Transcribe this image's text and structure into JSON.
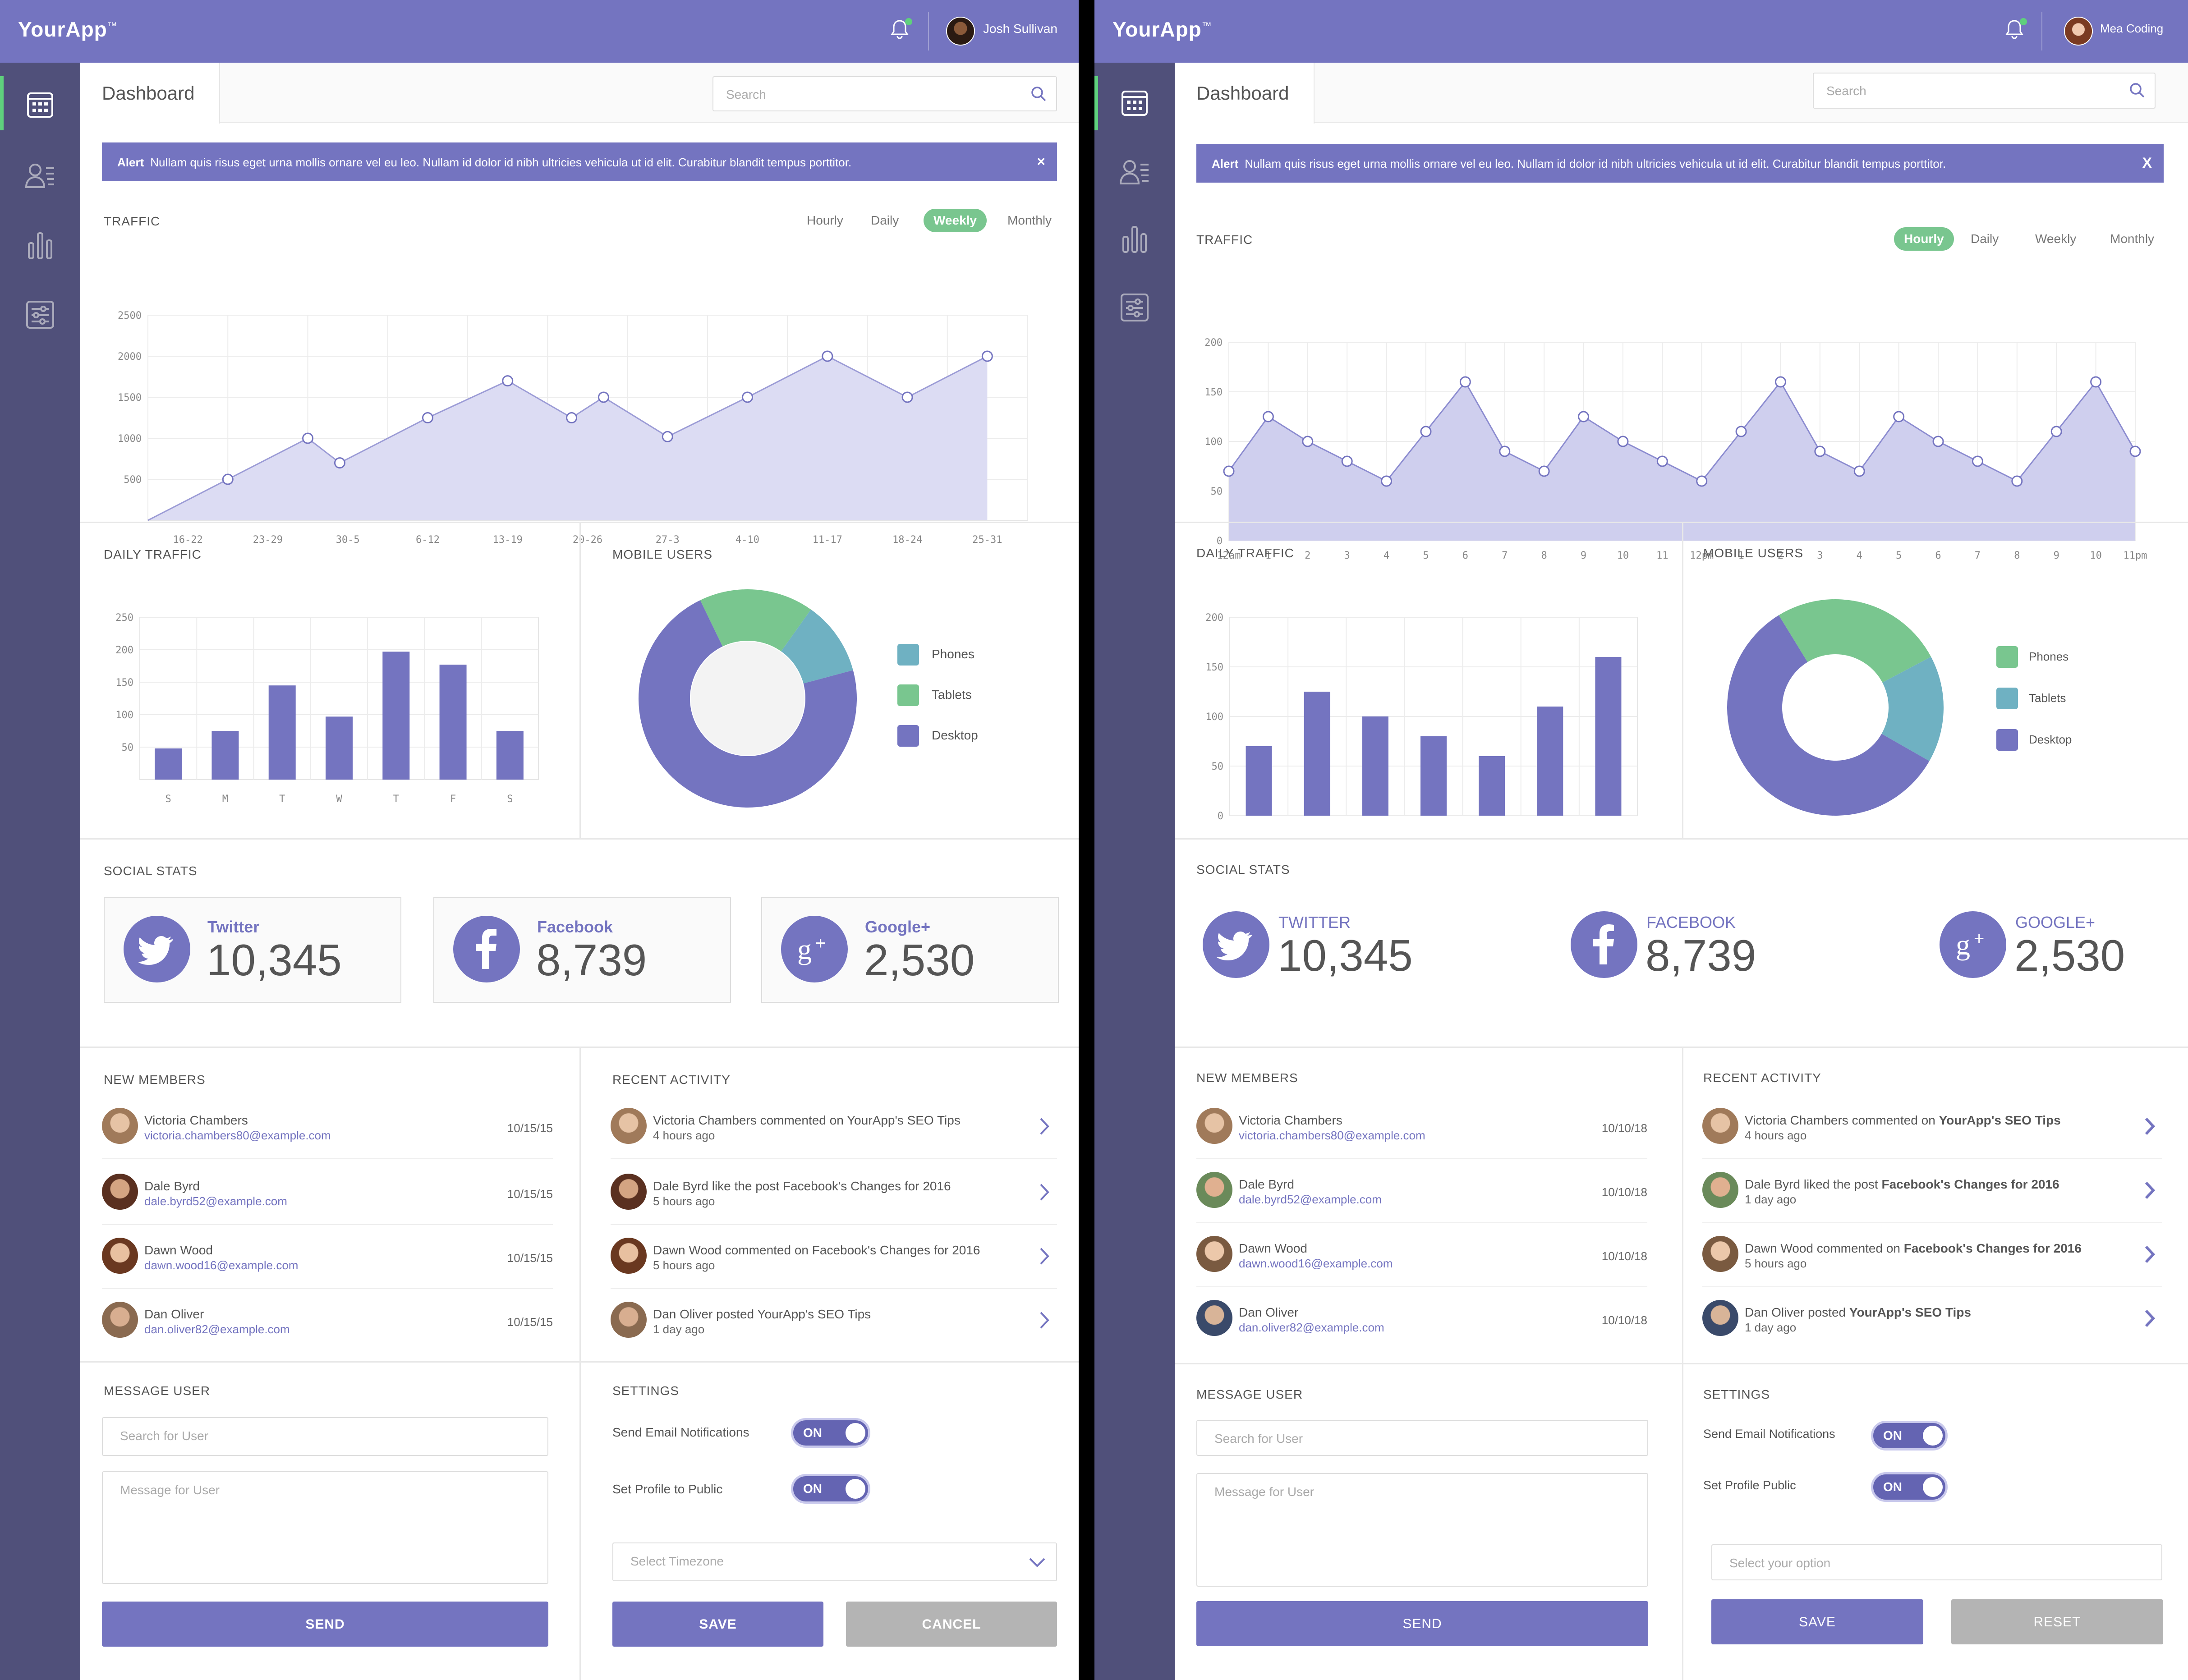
{
  "colors": {
    "accent": "#7474c0",
    "sidebar": "#50507a",
    "green": "#79c68f",
    "teal": "#6fb1c2",
    "grey_button": "#b4b4b4"
  },
  "screen1": {
    "app_name": "YourApp",
    "app_mark": "™",
    "user": "Josh Sullivan",
    "tab": "Dashboard",
    "search_placeholder": "Search",
    "alert": {
      "label": "Alert",
      "text": "Nullam quis risus eget urna mollis ornare vel eu leo. Nullam id dolor id nibh ultricies vehicula ut id elit. Curabitur blandit tempus porttitor.",
      "close": "×"
    },
    "traffic": {
      "title": "TRAFFIC",
      "toggles": [
        "Hourly",
        "Daily",
        "Weekly",
        "Monthly"
      ],
      "active": "Weekly"
    },
    "daily_traffic": {
      "title": "DAILY TRAFFIC"
    },
    "mobile_users": {
      "title": "MOBILE USERS",
      "legend": [
        "Phones",
        "Tablets",
        "Desktop"
      ]
    },
    "social": {
      "title": "SOCIAL STATS",
      "items": [
        {
          "name": "Twitter",
          "value": "10,345"
        },
        {
          "name": "Facebook",
          "value": "8,739"
        },
        {
          "name": "Google+",
          "value": "2,530"
        }
      ]
    },
    "members": {
      "title": "NEW MEMBERS",
      "items": [
        {
          "name": "Victoria Chambers",
          "email": "victoria.chambers80@example.com",
          "date": "10/15/15"
        },
        {
          "name": "Dale Byrd",
          "email": "dale.byrd52@example.com",
          "date": "10/15/15"
        },
        {
          "name": "Dawn Wood",
          "email": "dawn.wood16@example.com",
          "date": "10/15/15"
        },
        {
          "name": "Dan Oliver",
          "email": "dan.oliver82@example.com",
          "date": "10/15/15"
        }
      ]
    },
    "activity": {
      "title": "RECENT ACTIVITY",
      "items": [
        {
          "pre": "Victoria Chambers commented on ",
          "target": "YourApp's SEO Tips",
          "time": "4 hours ago"
        },
        {
          "pre": "Dale Byrd like the post ",
          "target": "Facebook's Changes for 2016",
          "time": "5 hours ago"
        },
        {
          "pre": "Dawn Wood commented on ",
          "target": "Facebook's Changes for 2016",
          "time": "5 hours ago"
        },
        {
          "pre": "Dan Oliver posted ",
          "target": "YourApp's SEO Tips",
          "time": "1 day ago"
        }
      ]
    },
    "message": {
      "title": "MESSAGE USER",
      "search_placeholder": "Search for User",
      "message_placeholder": "Message for User",
      "send": "SEND"
    },
    "settings": {
      "title": "SETTINGS",
      "email_label": "Send Email Notifications",
      "email_state": "ON",
      "public_label": "Set Profile to Public",
      "public_state": "ON",
      "timezone_placeholder": "Select Timezone",
      "save": "SAVE",
      "cancel": "CANCEL"
    }
  },
  "screen2": {
    "app_name": "YourApp",
    "app_mark": "™",
    "user": "Mea Coding",
    "tab": "Dashboard",
    "search_placeholder": "Search",
    "alert": {
      "label": "Alert",
      "text": "Nullam quis risus eget urna mollis ornare vel eu leo. Nullam id dolor id nibh ultricies vehicula ut id elit. Curabitur blandit tempus porttitor.",
      "close": "X"
    },
    "traffic": {
      "title": "TRAFFIC",
      "toggles": [
        "Hourly",
        "Daily",
        "Weekly",
        "Monthly"
      ],
      "active": "Hourly"
    },
    "daily_traffic": {
      "title": "DAILY TRAFFIC"
    },
    "mobile_users": {
      "title": "MOBILE USERS",
      "legend": [
        "Phones",
        "Tablets",
        "Desktop"
      ]
    },
    "social": {
      "title": "SOCIAL STATS",
      "items": [
        {
          "name": "TWITTER",
          "value": "10,345"
        },
        {
          "name": "FACEBOOK",
          "value": "8,739"
        },
        {
          "name": "GOOGLE+",
          "value": "2,530"
        }
      ]
    },
    "members": {
      "title": "NEW MEMBERS",
      "items": [
        {
          "name": "Victoria Chambers",
          "email": "victoria.chambers80@example.com",
          "date": "10/10/18"
        },
        {
          "name": "Dale Byrd",
          "email": "dale.byrd52@example.com",
          "date": "10/10/18"
        },
        {
          "name": "Dawn Wood",
          "email": "dawn.wood16@example.com",
          "date": "10/10/18"
        },
        {
          "name": "Dan Oliver",
          "email": "dan.oliver82@example.com",
          "date": "10/10/18"
        }
      ]
    },
    "activity": {
      "title": "RECENT ACTIVITY",
      "items": [
        {
          "pre": "Victoria Chambers commented on ",
          "target": "YourApp's SEO Tips",
          "time": "4 hours ago"
        },
        {
          "pre": "Dale Byrd liked the post ",
          "target": "Facebook's Changes for 2016",
          "time": "1 day ago"
        },
        {
          "pre": "Dawn Wood commented on ",
          "target": "Facebook's Changes for 2016",
          "time": "5 hours ago"
        },
        {
          "pre": "Dan Oliver posted ",
          "target": "YourApp's SEO Tips",
          "time": "1 day ago"
        }
      ]
    },
    "message": {
      "title": "MESSAGE USER",
      "search_placeholder": "Search for User",
      "message_placeholder": "Message for User",
      "send": "SEND"
    },
    "settings": {
      "title": "SETTINGS",
      "email_label": "Send Email Notifications",
      "email_state": "ON",
      "public_label": "Set Profile Public",
      "public_state": "ON",
      "timezone_placeholder": "Select your option",
      "save": "SAVE",
      "cancel": "RESET"
    }
  },
  "chart_data": [
    {
      "id": "s1_traffic",
      "type": "area",
      "title": "TRAFFIC",
      "categories": [
        "16-22",
        "23-29",
        "30-5",
        "6-12",
        "13-19",
        "20-26",
        "27-3",
        "4-10",
        "11-17",
        "18-24",
        "25-31"
      ],
      "x": [
        0,
        1,
        2,
        3,
        4,
        5,
        6,
        7,
        8,
        9,
        10,
        11
      ],
      "y": [
        0,
        500,
        1000,
        700,
        1250,
        1700,
        1250,
        1500,
        1020,
        1500,
        2000,
        1500,
        2000
      ],
      "points_x": [
        0,
        1,
        2,
        2.4,
        3.5,
        4.5,
        5.3,
        5.7,
        6.5,
        7.5,
        8.5,
        9.5,
        10.5
      ],
      "yticks": [
        500,
        1000,
        1500,
        2000,
        2500
      ],
      "ylim": [
        0,
        2500
      ]
    },
    {
      "id": "s1_daily",
      "type": "bar",
      "title": "DAILY TRAFFIC",
      "categories": [
        "S",
        "M",
        "T",
        "W",
        "T",
        "F",
        "S"
      ],
      "values": [
        48,
        75,
        145,
        97,
        197,
        177,
        75
      ],
      "yticks": [
        50,
        100,
        150,
        200,
        250
      ],
      "ylim": [
        0,
        250
      ]
    },
    {
      "id": "s1_mobile",
      "type": "pie",
      "title": "MOBILE USERS",
      "labels": [
        "Tablets",
        "Phones",
        "Desktop"
      ],
      "values": [
        17,
        11,
        72
      ]
    },
    {
      "id": "s2_traffic",
      "type": "area",
      "title": "TRAFFIC",
      "categories": [
        "12am",
        "1",
        "2",
        "3",
        "4",
        "5",
        "6",
        "7",
        "8",
        "9",
        "10",
        "11",
        "12pm",
        "1",
        "2",
        "3",
        "4",
        "5",
        "6",
        "7",
        "8",
        "9",
        "10",
        "11pm"
      ],
      "values": [
        70,
        125,
        100,
        80,
        60,
        110,
        160,
        90,
        70,
        125,
        100,
        80,
        60,
        110,
        160,
        90,
        70,
        125,
        100,
        80,
        60,
        110,
        160,
        90
      ],
      "yticks": [
        0,
        50,
        100,
        150,
        200
      ],
      "ylim": [
        0,
        200
      ]
    },
    {
      "id": "s2_daily",
      "type": "bar",
      "title": "DAILY TRAFFIC",
      "categories": [
        "S",
        "M",
        "T",
        "W",
        "T",
        "F",
        "S"
      ],
      "values": [
        70,
        125,
        100,
        80,
        60,
        110,
        160
      ],
      "yticks": [
        0,
        50,
        100,
        150,
        200
      ],
      "ylim": [
        0,
        200
      ]
    },
    {
      "id": "s2_mobile",
      "type": "pie",
      "title": "MOBILE USERS",
      "labels": [
        "Phones",
        "Tablets",
        "Desktop"
      ],
      "values": [
        26,
        16,
        58
      ]
    }
  ]
}
